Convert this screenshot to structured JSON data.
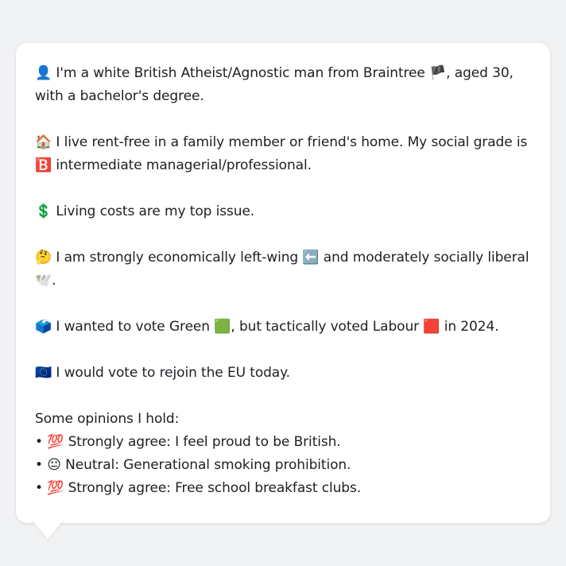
{
  "profile": {
    "p1": {
      "emoji": "👤",
      "text_a": " I'm a white British Atheist/Agnostic man from Braintree ",
      "flag": "🏴",
      "text_b": ", aged 30, with a bachelor's degree."
    },
    "p2": {
      "emoji": "🏠",
      "text_a": " I live rent-free in a family member or friend's home. My social grade is ",
      "grade_emoji": "🅱️",
      "text_b": " intermediate managerial/professional."
    },
    "p3": {
      "emoji": "💲",
      "text": " Living costs are my top issue."
    },
    "p4": {
      "emoji": "🤔",
      "text_a": " I am strongly economically left-wing ",
      "left_emoji": "⬅️",
      "text_b": " and moderately socially liberal ",
      "dove_emoji": "🕊️",
      "text_c": "."
    },
    "p5": {
      "emoji": "🗳️",
      "text_a": " I wanted to vote Green ",
      "green_emoji": "🟩",
      "text_b": ", but tactically voted Labour ",
      "red_emoji": "🟥",
      "text_c": " in 2024."
    },
    "p6": {
      "emoji": "🇪🇺",
      "text": " I would vote to rejoin the EU today."
    },
    "opinions": {
      "heading": "Some opinions I hold:",
      "items": [
        {
          "bullet": "• ",
          "emoji": "💯",
          "text": " Strongly agree: I feel proud to be British."
        },
        {
          "bullet": "• ",
          "emoji": "😐",
          "text": " Neutral: Generational smoking prohibition."
        },
        {
          "bullet": "• ",
          "emoji": "💯",
          "text": " Strongly agree: Free school breakfast clubs."
        }
      ]
    }
  }
}
